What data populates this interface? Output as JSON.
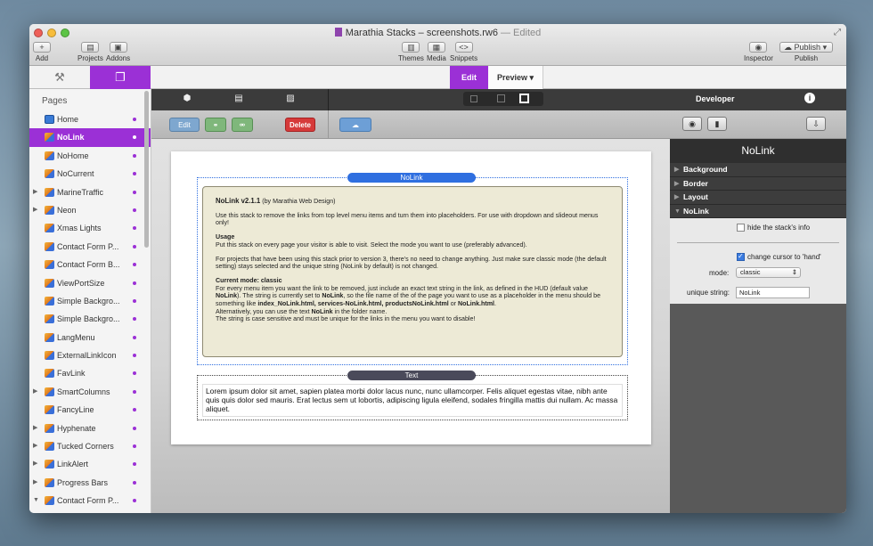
{
  "window": {
    "title": "Marathia Stacks – screenshots.rw6",
    "edited": "— Edited"
  },
  "toolbar": {
    "add": "Add",
    "projects": "Projects",
    "addons": "Addons",
    "themes": "Themes",
    "media": "Media",
    "snippets": "Snippets",
    "inspector": "Inspector",
    "publish_button": "Publish",
    "publish": "Publish"
  },
  "modes": {
    "edit": "Edit",
    "preview": "Preview"
  },
  "sidebar": {
    "header": "Pages",
    "items": [
      {
        "label": "Home",
        "type": "home",
        "expand": ""
      },
      {
        "label": "NoLink",
        "type": "stack",
        "expand": ""
      },
      {
        "label": "NoHome",
        "type": "stack",
        "expand": ""
      },
      {
        "label": "NoCurrent",
        "type": "stack",
        "expand": ""
      },
      {
        "label": "MarineTraffic",
        "type": "stack",
        "expand": "▶"
      },
      {
        "label": "Neon",
        "type": "stack",
        "expand": "▶"
      },
      {
        "label": "Xmas Lights",
        "type": "stack",
        "expand": ""
      },
      {
        "label": "Contact Form P...",
        "type": "stack",
        "expand": ""
      },
      {
        "label": "Contact Form B...",
        "type": "stack",
        "expand": ""
      },
      {
        "label": "ViewPortSize",
        "type": "stack",
        "expand": ""
      },
      {
        "label": "Simple Backgro...",
        "type": "stack",
        "expand": ""
      },
      {
        "label": "Simple Backgro...",
        "type": "stack",
        "expand": ""
      },
      {
        "label": "LangMenu",
        "type": "stack",
        "expand": ""
      },
      {
        "label": "ExternalLinkIcon",
        "type": "stack",
        "expand": ""
      },
      {
        "label": "FavLink",
        "type": "stack",
        "expand": ""
      },
      {
        "label": "SmartColumns",
        "type": "stack",
        "expand": "▶"
      },
      {
        "label": "FancyLine",
        "type": "stack",
        "expand": ""
      },
      {
        "label": "Hyphenate",
        "type": "stack",
        "expand": "▶"
      },
      {
        "label": "Tucked Corners",
        "type": "stack",
        "expand": "▶"
      },
      {
        "label": "LinkAlert",
        "type": "stack",
        "expand": "▶"
      },
      {
        "label": "Progress Bars",
        "type": "stack",
        "expand": "▶"
      },
      {
        "label": "Contact Form P...",
        "type": "stack",
        "expand": "▼"
      }
    ]
  },
  "editbar": {
    "edit": "Edit",
    "delete": "Delete"
  },
  "stacks": {
    "nolink_label": "NoLink",
    "nolink_title": "NoLink v2.1.1",
    "nolink_by": "(by Marathia Web Design)",
    "p1": "Use this stack to remove the links from top level menu items and turn them into placeholders. For use with dropdown and slideout menus only!",
    "usage_title": "Usage",
    "usage": "Put this stack on every page your visitor is able to visit. Select the mode you want to use (preferably advanced).",
    "p3": "For projects that have been using this stack prior to version 3, there's no need to change anything. Just make sure classic mode (the default setting) stays selected and the unique string (NoLink by default) is not changed.",
    "mode_title": "Current mode: classic",
    "m1": "For every menu item you want the link to be removed, just include an exact text string in the link, as defined in the HUD (default value ",
    "m1b": "NoLink",
    "m2": "). The string is currently set to ",
    "m2b": "NoLink",
    "m3": ", so the file name of the of the page you want to use as a placeholder in the menu should be something like ",
    "m3b": "index_NoLink.html, services-NoLink.html, productsNoLink.html",
    "m4": " or ",
    "m4b": "NoLink.html",
    "m5": ".",
    "alt1": "Alternatively, you can use the text ",
    "alt1b": "NoLink",
    "alt2": " in the folder name.",
    "case": "The string is case sensitive and must be unique for the links in the menu you want to disable!",
    "text_label": "Text",
    "lorem": "Lorem ipsum dolor sit amet, sapien platea morbi dolor lacus nunc, nunc ullamcorper. Felis aliquet egestas vitae, nibh ante quis quis dolor sed mauris. Erat lectus sem ut lobortis, adipiscing ligula eleifend, sodales fringilla mattis dui nullam. Ac massa aliquet."
  },
  "inspector": {
    "developer": "Developer",
    "title": "NoLink",
    "sections": [
      "Background",
      "Border",
      "Layout",
      "NoLink"
    ],
    "hide_info": "hide the stack's info",
    "hide_info_checked": false,
    "cursor": "change cursor to 'hand'",
    "cursor_checked": true,
    "mode_label": "mode:",
    "mode_value": "classic",
    "unique_label": "unique string:",
    "unique_value": "NoLink"
  },
  "colors": {
    "accent": "#9b30d6",
    "stack_blue": "#2f6fe0",
    "delete": "#d63a3a"
  }
}
